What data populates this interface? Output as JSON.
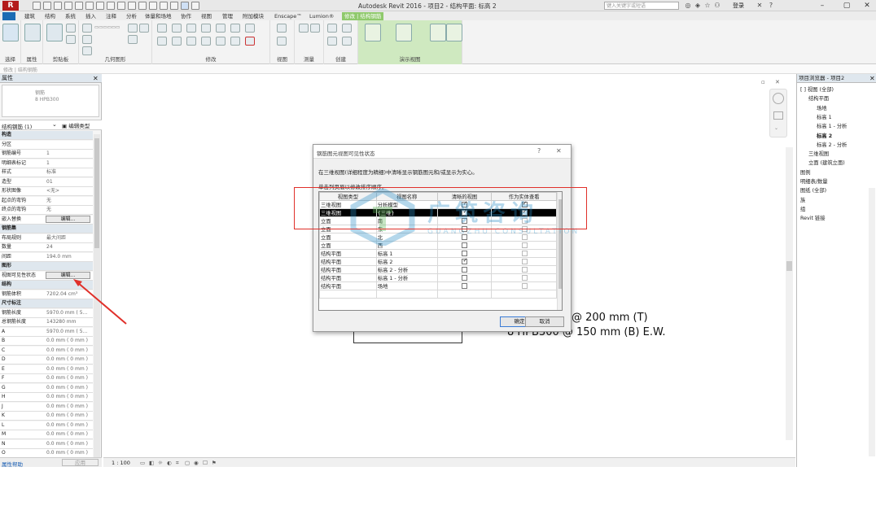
{
  "window": {
    "title": "Autodesk Revit 2016 -  项目2 - 结构平面: 标高 2",
    "search_placeholder": "键入关键字或短语",
    "login": "登录",
    "logo": "R"
  },
  "tabs": [
    "建筑",
    "结构",
    "系统",
    "插入",
    "注释",
    "分析",
    "体量和场地",
    "协作",
    "视图",
    "管理",
    "附加模块",
    "Enscape™",
    "Lumion®",
    "修改 | 结构钢筋"
  ],
  "ribbon": {
    "groups": [
      {
        "label": "选择"
      },
      {
        "label": "属性"
      },
      {
        "label": "剪贴板"
      },
      {
        "label": "几何图形"
      },
      {
        "label": "修改"
      },
      {
        "label": "视图"
      },
      {
        "label": "测量"
      },
      {
        "label": "创建"
      },
      {
        "label": "演示视图"
      }
    ],
    "show_labels": [
      "显示\n选择",
      "显示\n第一个钢筋",
      "显示\n中间",
      "选择"
    ]
  },
  "context_bar": "修改 | 结构钢筋",
  "properties": {
    "title": "属性",
    "type_name": "钢筋",
    "type_sub": "8 HPB300",
    "selector": "结构钢筋 (1)",
    "edit_type": "编辑类型",
    "rows": [
      {
        "k": "构造",
        "cat": true
      },
      {
        "k": "分区",
        "v": ""
      },
      {
        "k": "钢筋编号",
        "v": "1"
      },
      {
        "k": "明细表标记",
        "v": "1"
      },
      {
        "k": "样式",
        "v": "标准"
      },
      {
        "k": "造型",
        "v": "01"
      },
      {
        "k": "形状图像",
        "v": "<无>"
      },
      {
        "k": "起点的弯钩",
        "v": "无"
      },
      {
        "k": "终点的弯钩",
        "v": "无"
      },
      {
        "k": "嵌入替换",
        "btn": "编辑..."
      },
      {
        "k": "钢筋集",
        "cat": true
      },
      {
        "k": "布局规则",
        "v": "最大间距"
      },
      {
        "k": "数量",
        "v": "24"
      },
      {
        "k": "间距",
        "v": "194.0 mm"
      },
      {
        "k": "图形",
        "cat": true
      },
      {
        "k": "视图可见性状态",
        "btn": "编辑..."
      },
      {
        "k": "结构",
        "cat": true
      },
      {
        "k": "钢筋体积",
        "v": "7202.04 cm³"
      },
      {
        "k": "尺寸标注",
        "cat": true
      },
      {
        "k": "钢筋长度",
        "v": "5970.0 mm ( 5..."
      },
      {
        "k": "总钢筋长度",
        "v": "143280 mm"
      },
      {
        "k": "A",
        "v": "5970.0 mm ( 5..."
      },
      {
        "k": "B",
        "v": "0.0 mm ( 0 mm )"
      },
      {
        "k": "C",
        "v": "0.0 mm ( 0 mm )"
      },
      {
        "k": "D",
        "v": "0.0 mm ( 0 mm )"
      },
      {
        "k": "E",
        "v": "0.0 mm ( 0 mm )"
      },
      {
        "k": "F",
        "v": "0.0 mm ( 0 mm )"
      },
      {
        "k": "G",
        "v": "0.0 mm ( 0 mm )"
      },
      {
        "k": "H",
        "v": "0.0 mm ( 0 mm )"
      },
      {
        "k": "J",
        "v": "0.0 mm ( 0 mm )"
      },
      {
        "k": "K",
        "v": "0.0 mm ( 0 mm )"
      },
      {
        "k": "L",
        "v": "0.0 mm ( 0 mm )"
      },
      {
        "k": "M",
        "v": "0.0 mm ( 0 mm )"
      },
      {
        "k": "N",
        "v": "0.0 mm ( 0 mm )"
      },
      {
        "k": "O",
        "v": "0.0 mm ( 0 mm )"
      }
    ],
    "footer_link": "属性帮助",
    "footer_apply": "应用"
  },
  "canvas": {
    "annotation_1": "@ 200 mm (T)",
    "annotation_2": "8 HPB300 @ 150 mm (B) E.W."
  },
  "status": {
    "scale": "1 : 100"
  },
  "browser": {
    "title": "项目浏览器 - 项目2",
    "items": [
      {
        "t": "[ ] 视图 (全部)",
        "lvl": 0
      },
      {
        "t": "结构平面",
        "lvl": 1
      },
      {
        "t": "场地",
        "lvl": 2
      },
      {
        "t": "标高 1",
        "lvl": 2
      },
      {
        "t": "标高 1 - 分析",
        "lvl": 2
      },
      {
        "t": "标高 2",
        "lvl": 2,
        "bold": true
      },
      {
        "t": "标高 2 - 分析",
        "lvl": 2
      },
      {
        "t": "三维视图",
        "lvl": 1
      },
      {
        "t": "立面 (建筑立面)",
        "lvl": 1
      },
      {
        "t": "图例",
        "lvl": 0
      },
      {
        "t": "明细表/数量",
        "lvl": 0
      },
      {
        "t": "图纸 (全部)",
        "lvl": 0
      },
      {
        "t": "族",
        "lvl": 0
      },
      {
        "t": "组",
        "lvl": 0
      },
      {
        "t": "Revit 链接",
        "lvl": 0
      }
    ]
  },
  "dialog": {
    "title": "钢筋图元视图可见性状态",
    "help": "?",
    "close": "✕",
    "description": "在三维视图(详细程度为精细)中清晰显示钢筋图元和/或显示为实心。",
    "sort_hint": "单击列页眉以修改排序顺序。",
    "headers": [
      "视图类型",
      "视图名称",
      "清晰的视图",
      "作为实体查看"
    ],
    "rows": [
      {
        "type": "三维视图",
        "name": "分析模型",
        "clear": true,
        "solid": true,
        "selected": false
      },
      {
        "type": "三维视图",
        "name": "{三维}",
        "clear": true,
        "solid": true,
        "selected": true
      },
      {
        "type": "立面",
        "name": "南",
        "clear": false,
        "solid": false,
        "selected": false
      },
      {
        "type": "立面",
        "name": "东",
        "clear": false,
        "solid": false,
        "selected": false
      },
      {
        "type": "立面",
        "name": "北",
        "clear": false,
        "solid": false,
        "selected": false
      },
      {
        "type": "立面",
        "name": "西",
        "clear": false,
        "solid": false,
        "selected": false
      },
      {
        "type": "结构平面",
        "name": "标高 1",
        "clear": false,
        "solid": false,
        "selected": false
      },
      {
        "type": "结构平面",
        "name": "标高 2",
        "clear": true,
        "solid": false,
        "selected": false
      },
      {
        "type": "结构平面",
        "name": "标高 2 - 分析",
        "clear": false,
        "solid": false,
        "selected": false
      },
      {
        "type": "结构平面",
        "name": "标高 1 - 分析",
        "clear": false,
        "solid": false,
        "selected": false
      },
      {
        "type": "结构平面",
        "name": "场地",
        "clear": false,
        "solid": false,
        "selected": false
      }
    ],
    "ok": "确定",
    "cancel": "取消"
  },
  "watermark": {
    "zh": "广筑咨询",
    "en": "GUANGZHU CONSULTATION"
  },
  "colors": {
    "highlight": "#e0302a",
    "arrow": "#e0302a",
    "tab_active": "#8fc96c",
    "watermark": "#2a8fc8"
  }
}
